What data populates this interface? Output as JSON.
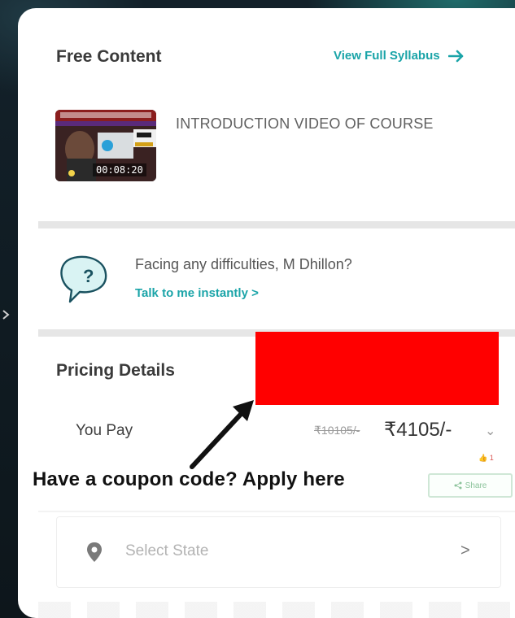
{
  "free_content": {
    "title": "Free Content",
    "syllabus_link": "View Full Syllabus",
    "video": {
      "title": "INTRODUCTION VIDEO OF COURSE",
      "duration": "00:08:20"
    }
  },
  "help": {
    "text": "Facing any difficulties, M Dhillon?",
    "link": "Talk to me instantly >"
  },
  "pricing": {
    "title": "Pricing Details",
    "you_pay_label": "You Pay",
    "old_price": "₹10105/-",
    "new_price": "₹4105/-",
    "chevron": "⌄",
    "likes": "👍 1",
    "share_label": "Share"
  },
  "annotation": {
    "coupon_text": "Have a coupon code? Apply here",
    "highlight_color": "#ff0000"
  },
  "state_selector": {
    "placeholder": "Select State",
    "chevron": ">"
  },
  "colors": {
    "accent": "#1aa4a8",
    "background": "#0f1a20",
    "card": "#ffffff"
  }
}
